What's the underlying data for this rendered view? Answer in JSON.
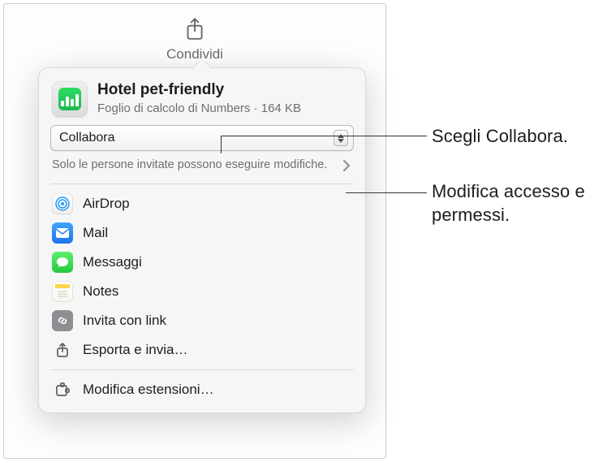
{
  "share_button": {
    "label": "Condividi"
  },
  "document": {
    "title": "Hotel pet-friendly",
    "subtitle": "Foglio di calcolo di Numbers · 164 KB"
  },
  "mode_dropdown": {
    "selected": "Collabora"
  },
  "permissions": {
    "summary": "Solo le persone invitate possono eseguire modifiche."
  },
  "share_targets": [
    {
      "key": "airdrop",
      "label": "AirDrop"
    },
    {
      "key": "mail",
      "label": "Mail"
    },
    {
      "key": "messages",
      "label": "Messaggi"
    },
    {
      "key": "notes",
      "label": "Notes"
    },
    {
      "key": "invite-link",
      "label": "Invita con link"
    },
    {
      "key": "export-send",
      "label": "Esporta e invia…"
    }
  ],
  "edit_extensions": {
    "label": "Modifica estensioni…"
  },
  "callouts": {
    "choose_collaborate": "Scegli Collabora.",
    "modify_access": "Modifica accesso e permessi."
  }
}
